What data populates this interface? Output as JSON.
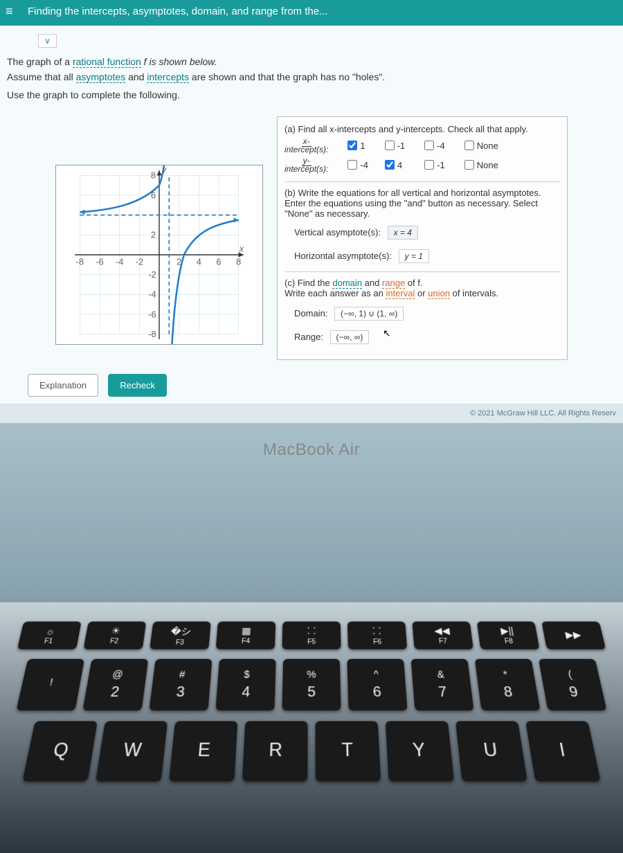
{
  "header": {
    "title": "Finding the intercepts, asymptotes, domain, and range from the..."
  },
  "problem": {
    "intro1a": "The graph of a ",
    "link1": "rational function",
    "intro1b": " f is shown below.",
    "intro2a": "Assume that all ",
    "link2a": "asymptotes",
    "intro2b": " and ",
    "link2b": "intercepts",
    "intro2c": " are shown and that the graph has no \"holes\".",
    "intro3": "Use the graph to complete the following."
  },
  "partA": {
    "title": "(a) Find all x-intercepts and y-intercepts. Check all that apply.",
    "xlabel_top": "x-",
    "xlabel_bot": "intercept(s):",
    "ylabel_top": "y-",
    "ylabel_bot": "intercept(s):",
    "xopts": [
      "1",
      "-1",
      "-4",
      "None"
    ],
    "yopts": [
      "-4",
      "4",
      "-1",
      "None"
    ]
  },
  "partB": {
    "title": "(b) Write the equations for all vertical and horizontal asymptotes. Enter the equations using the \"and\" button as necessary. Select \"None\" as necessary.",
    "va_label": "Vertical asymptote(s):",
    "va_value": "x = 4",
    "ha_label": "Horizontal asymptote(s):",
    "ha_value": "y = 1"
  },
  "partC": {
    "title1": "(c) Find the ",
    "link_domain": "domain",
    "title2": " and ",
    "link_range": "range",
    "title3": " of f.",
    "subtitle1": "Write each answer as an ",
    "link_interval": "interval",
    "subtitle2": " or ",
    "link_union": "union",
    "subtitle3": " of intervals.",
    "domain_label": "Domain:",
    "domain_value": "(−∞, 1) ∪ (1, ∞)",
    "range_label": "Range:",
    "range_value": "(−∞, ∞)"
  },
  "buttons": {
    "explanation": "Explanation",
    "recheck": "Recheck"
  },
  "copyright": "© 2021 McGraw Hill LLC. All Rights Reserv",
  "laptop": "MacBook Air",
  "fkeys": [
    {
      "icon": "☼",
      "label": "F1"
    },
    {
      "icon": "☀",
      "label": "F2"
    },
    {
      "icon": "�シ",
      "label": "F3"
    },
    {
      "icon": "▦",
      "label": "F4"
    },
    {
      "icon": "⸬",
      "label": "F5"
    },
    {
      "icon": "⸬",
      "label": "F6"
    },
    {
      "icon": "◀◀",
      "label": "F7"
    },
    {
      "icon": "▶||",
      "label": "F8"
    },
    {
      "icon": "▶▶",
      "label": ""
    }
  ],
  "numkeys": [
    {
      "top": "!",
      "bot": ""
    },
    {
      "top": "@",
      "bot": "2"
    },
    {
      "top": "#",
      "bot": "3"
    },
    {
      "top": "$",
      "bot": "4"
    },
    {
      "top": "%",
      "bot": "5"
    },
    {
      "top": "^",
      "bot": "6"
    },
    {
      "top": "&",
      "bot": "7"
    },
    {
      "top": "*",
      "bot": "8"
    },
    {
      "top": "(",
      "bot": "9"
    }
  ],
  "letkeys": [
    "Q",
    "W",
    "E",
    "R",
    "T",
    "Y",
    "U",
    "I"
  ],
  "chart_data": {
    "type": "line",
    "title": "",
    "xlabel": "x",
    "ylabel": "y",
    "xlim": [
      -8,
      8
    ],
    "ylim": [
      -8,
      8
    ],
    "vertical_asymptote": 1,
    "horizontal_asymptote": 4,
    "series": [
      {
        "name": "f-left-branch",
        "x": [
          -8,
          -6,
          -4,
          -2,
          -1,
          0,
          0.5,
          0.8
        ],
        "y": [
          4.3,
          4.4,
          4.6,
          5,
          5.5,
          7,
          10,
          20
        ]
      },
      {
        "name": "f-right-branch",
        "x": [
          1.2,
          1.5,
          2,
          3,
          4,
          6,
          8
        ],
        "y": [
          -20,
          -8,
          -2,
          1,
          2,
          3,
          3.5
        ]
      }
    ]
  }
}
